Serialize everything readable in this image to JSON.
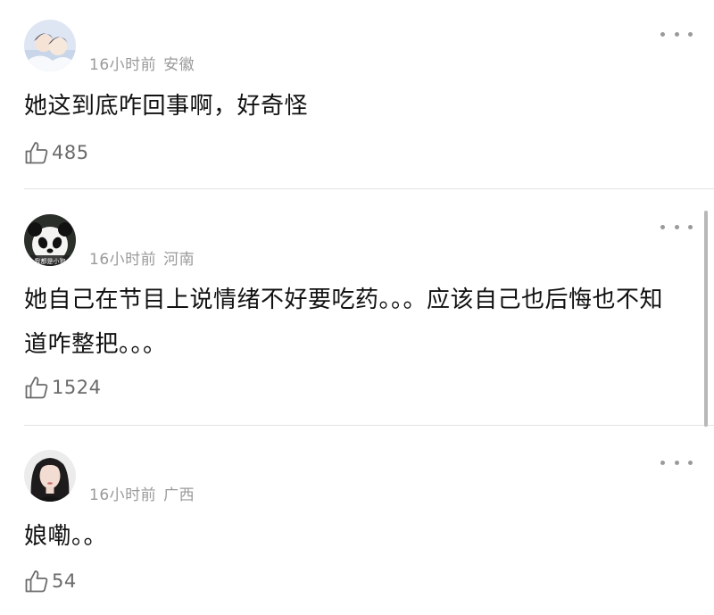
{
  "comments": [
    {
      "username": "",
      "time": "16小时前",
      "location": "安徽",
      "text": "她这到底咋回事啊，好奇怪",
      "likes": "485",
      "avatar": "anime-couple-avatar"
    },
    {
      "username": "",
      "time": "16小时前",
      "location": "河南",
      "text": "她自己在节目上说情绪不好要吃药。。。应该自己也后悔也不知道咋整把。。。",
      "likes": "1524",
      "avatar": "panda-avatar",
      "avatar_caption": "我都是小狗"
    },
    {
      "username": "",
      "time": "16小时前",
      "location": "广西",
      "text": "娘嘞。。",
      "likes": "54",
      "avatar": "woman-portrait-avatar"
    }
  ],
  "colors": {
    "text": "#111111",
    "meta": "#9a9a9a",
    "like": "#6b6b6b",
    "divider": "#e3e3e3",
    "scrollbar": "#b8b8b8"
  },
  "icons": {
    "more": "more-dots-icon",
    "like": "thumbs-up-icon"
  }
}
